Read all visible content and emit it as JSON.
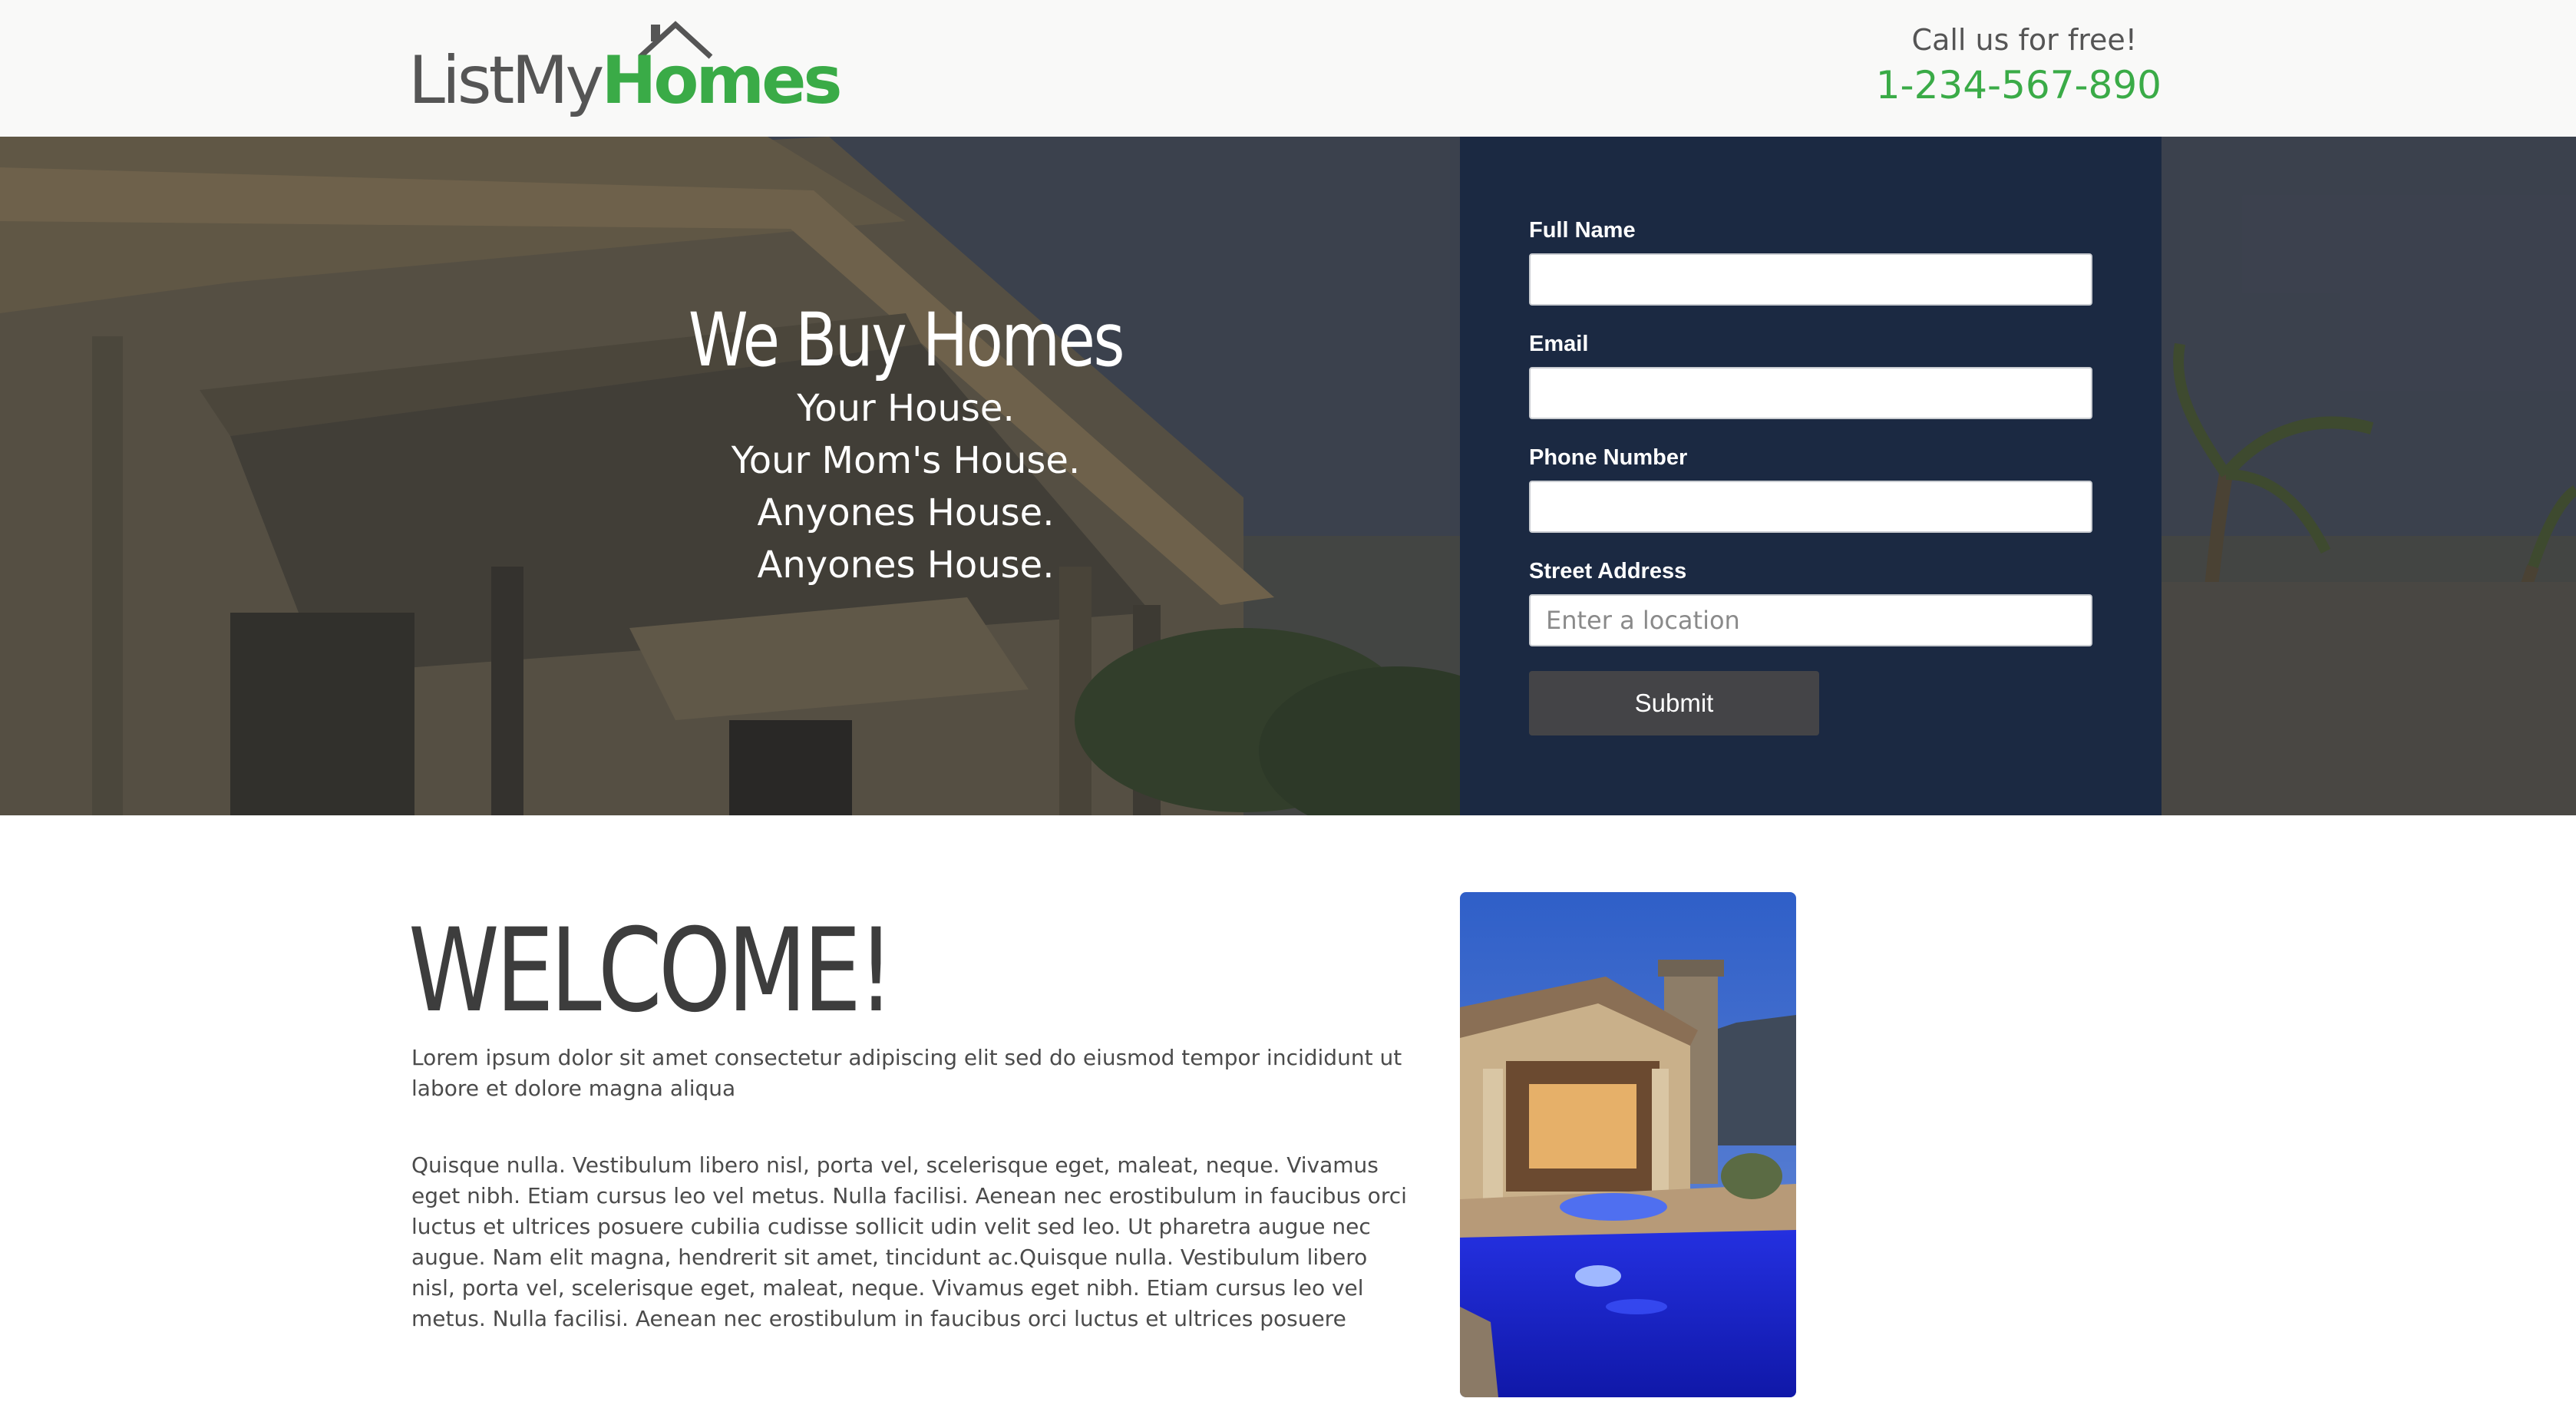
{
  "header": {
    "logo": {
      "light": "ListMy",
      "bold": "Homes"
    },
    "call_label": "Call us for free!",
    "phone": "1-234-567-890"
  },
  "hero": {
    "title": "We Buy Homes",
    "lines": [
      "Your House.",
      "Your Mom's House.",
      "Anyones House.",
      "Anyones House."
    ]
  },
  "form": {
    "fields": [
      {
        "label": "Full Name",
        "value": "",
        "placeholder": ""
      },
      {
        "label": "Email",
        "value": "",
        "placeholder": ""
      },
      {
        "label": "Phone Number",
        "value": "",
        "placeholder": ""
      },
      {
        "label": "Street Address",
        "value": "",
        "placeholder": "Enter a location"
      }
    ],
    "submit_label": "Submit"
  },
  "content": {
    "heading": "WELCOME!",
    "intro": "Lorem ipsum dolor sit amet consectetur adipiscing elit sed do eiusmod tempor incididunt ut labore et dolore magna aliqua",
    "body": "Quisque nulla. Vestibulum libero nisl, porta vel, scelerisque eget, maleat, neque. Vivamus eget nibh. Etiam cursus leo vel metus. Nulla facilisi. Aenean nec erostibulum in faucibus orci luctus et ultrices posuere cubilia cudisse sollicit udin velit sed leo. Ut pharetra augue nec augue. Nam elit magna, hendrerit sit amet, tincidunt ac.Quisque nulla. Vestibulum libero nisl, porta vel, scelerisque eget, maleat, neque. Vivamus eget nibh. Etiam cursus leo vel metus. Nulla facilisi. Aenean nec erostibulum in faucibus orci luctus et ultrices posuere"
  },
  "colors": {
    "brand_green": "#3aab47",
    "form_panel": "#1b2942",
    "submit_button": "#444447",
    "header_bg": "#f9f9f8"
  }
}
